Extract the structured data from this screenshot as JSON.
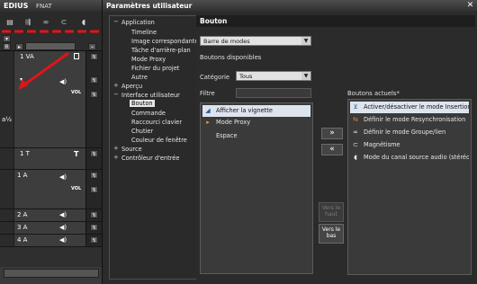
{
  "edius": {
    "app_name": "EDIUS",
    "project": "FNAT",
    "toolbar_icons": [
      "layout-icon",
      "sequence-icon",
      "link-icon",
      "sync-icon",
      "audio-wave-icon"
    ],
    "tracks": [
      {
        "label": "1 VA"
      },
      {
        "label": "1 T"
      },
      {
        "label": "1 A"
      },
      {
        "label": "2 A"
      },
      {
        "label": "3 A"
      },
      {
        "label": "4 A"
      }
    ],
    "vol_label": "VOL"
  },
  "dialog": {
    "title": "Paramètres utilisateur",
    "close": "✕",
    "tree": [
      {
        "label": "Application",
        "level": 0,
        "expander": "−"
      },
      {
        "label": "Timeline",
        "level": 1
      },
      {
        "label": "Image correspondante",
        "level": 1
      },
      {
        "label": "Tâche d'arrière-plan",
        "level": 1
      },
      {
        "label": "Mode Proxy",
        "level": 1
      },
      {
        "label": "Fichier du projet",
        "level": 1
      },
      {
        "label": "Autre",
        "level": 1
      },
      {
        "label": "Aperçu",
        "level": 0,
        "expander": "+"
      },
      {
        "label": "Interface utilisateur",
        "level": 0,
        "expander": "−"
      },
      {
        "label": "Bouton",
        "level": 1,
        "selected": true
      },
      {
        "label": "Commande",
        "level": 1
      },
      {
        "label": "Raccourci clavier",
        "level": 1
      },
      {
        "label": "Chutier",
        "level": 1
      },
      {
        "label": "Couleur de fenêtre",
        "level": 1
      },
      {
        "label": "Source",
        "level": 0,
        "expander": "+"
      },
      {
        "label": "Contrôleur d'entrée",
        "level": 0,
        "expander": "+"
      }
    ],
    "section_title": "Bouton",
    "bar_select": "Barre de modes",
    "available_label": "Boutons disponibles",
    "category_label": "Catégorie",
    "category_value": "Tous",
    "filter_label": "Filtre",
    "filter_value": "",
    "available": [
      {
        "label": "Afficher la vignette",
        "icon": "thumbnail-icon",
        "glyph": "◢",
        "highlight": true
      },
      {
        "label": "Mode Proxy",
        "icon": "proxy-icon",
        "glyph": "▸"
      },
      {
        "label": "Espace",
        "icon": "",
        "glyph": ""
      }
    ],
    "add_button": "»",
    "remove_button": "«",
    "up_button": "Vers le haut",
    "down_button": "Vers le bas",
    "current_label": "Boutons actuels*",
    "current": [
      {
        "label": "Activer/désactiver le mode Insertion",
        "icon": "insert-mode-icon",
        "glyph": "⊻",
        "highlight": true
      },
      {
        "label": "Définir le mode Resynchronisation",
        "icon": "resync-icon",
        "glyph": "⇆"
      },
      {
        "label": "Définir le mode Groupe/lien",
        "icon": "group-link-icon",
        "glyph": "∞"
      },
      {
        "label": "Magnétisme",
        "icon": "magnet-icon",
        "glyph": "⊂"
      },
      {
        "label": "Mode du canal source audio (stéréo",
        "icon": "audio-channel-icon",
        "glyph": "◖"
      }
    ]
  }
}
